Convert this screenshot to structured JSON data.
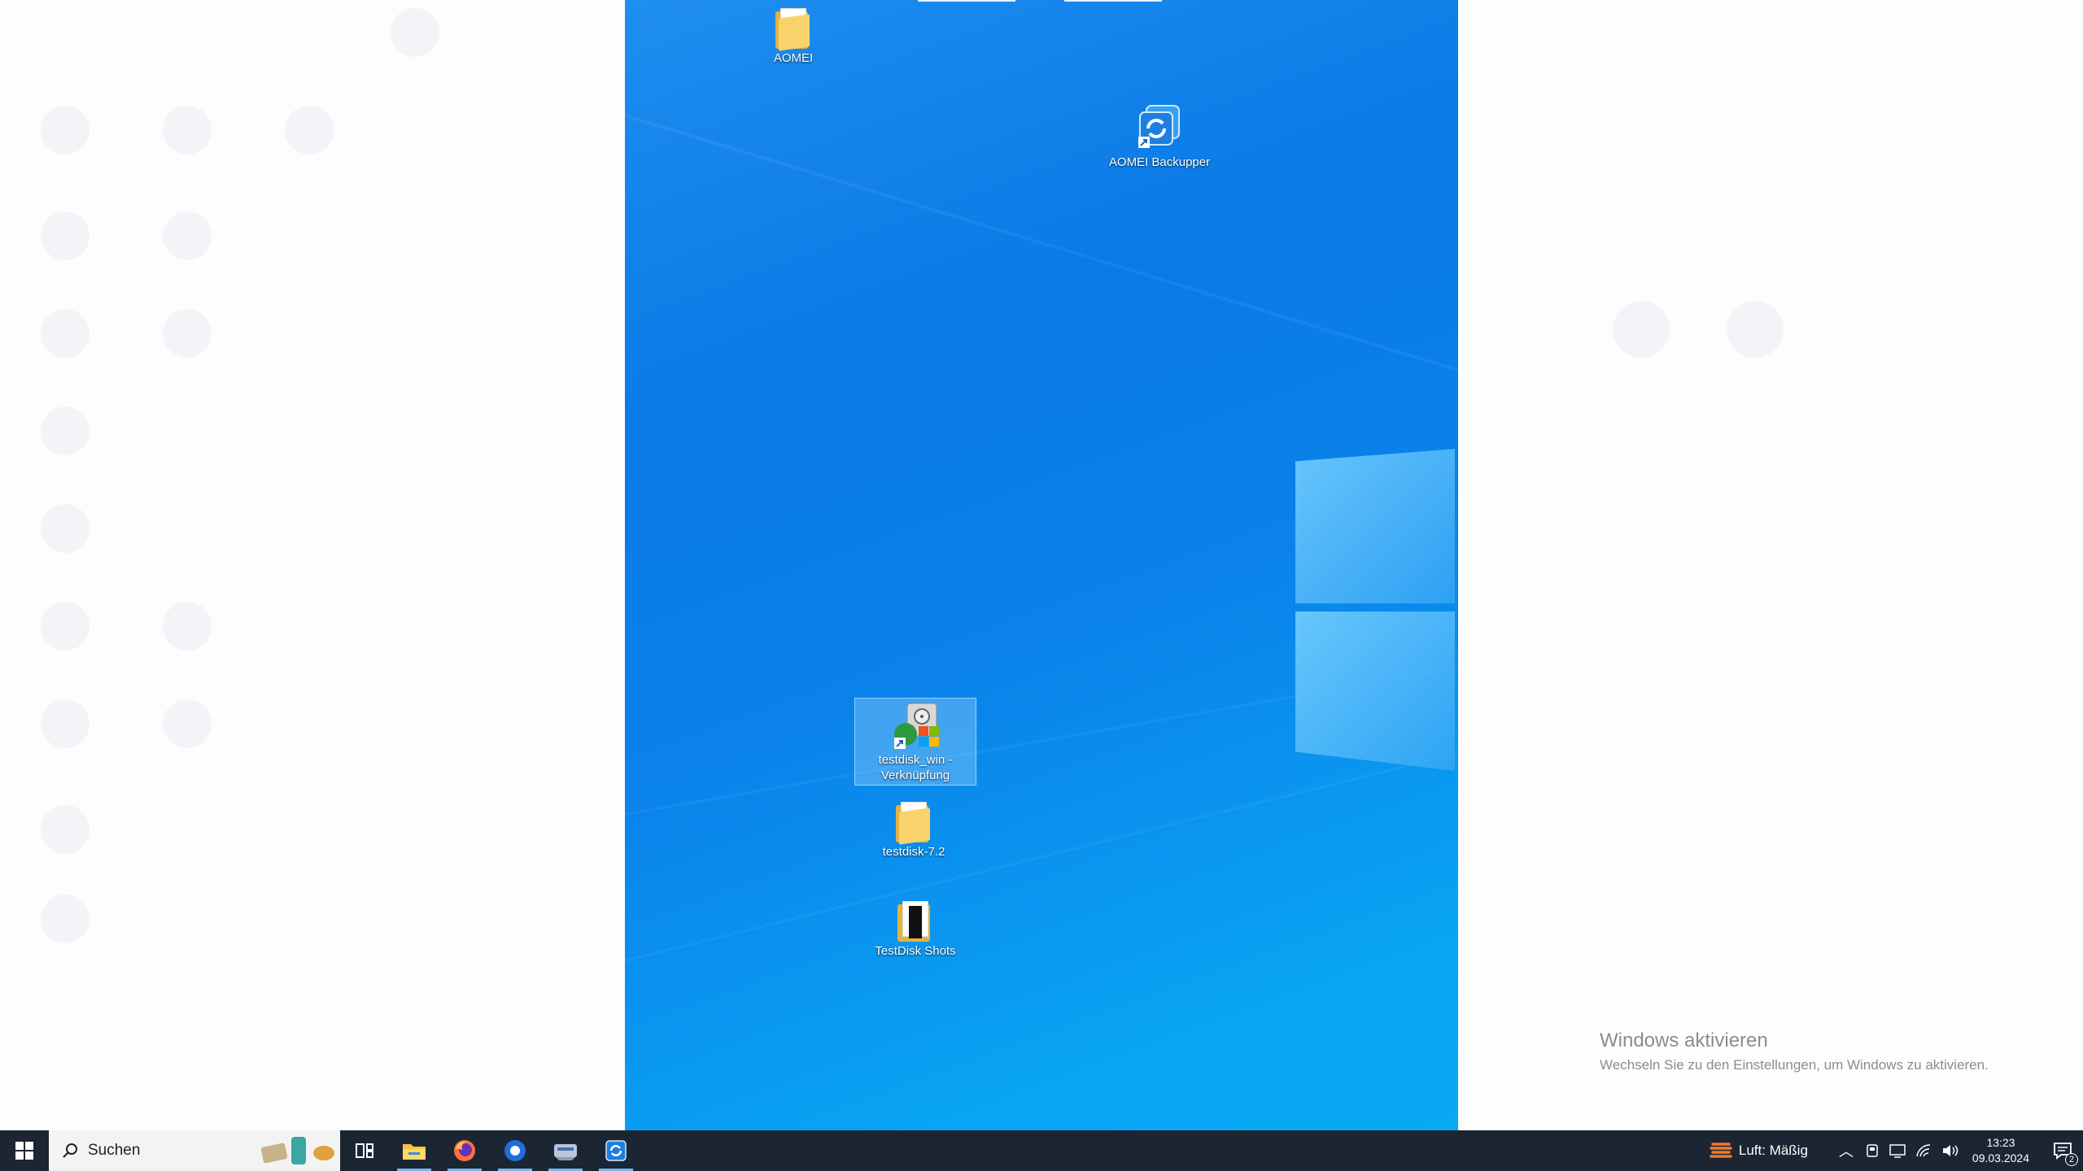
{
  "desktop": {
    "icons": [
      {
        "label": "AOMEI"
      },
      {
        "label": "AOMEI Backupper"
      },
      {
        "label": "testdisk_win - Verknüpfung"
      },
      {
        "label": "testdisk-7.2"
      },
      {
        "label": "TestDisk Shots"
      }
    ]
  },
  "watermark": {
    "title": "Windows aktivieren",
    "subtitle": "Wechseln Sie zu den Einstellungen, um Windows zu aktivieren."
  },
  "taskbar": {
    "search_label": "Suchen",
    "weather_text": "Luft: Mäßig",
    "time": "13:23",
    "date": "09.03.2024",
    "notification_count": "2"
  },
  "colors": {
    "taskbar_bg": "#1c2532",
    "wallpaper_blue": "#0a7ae6",
    "accent": "#7ab7f0"
  }
}
